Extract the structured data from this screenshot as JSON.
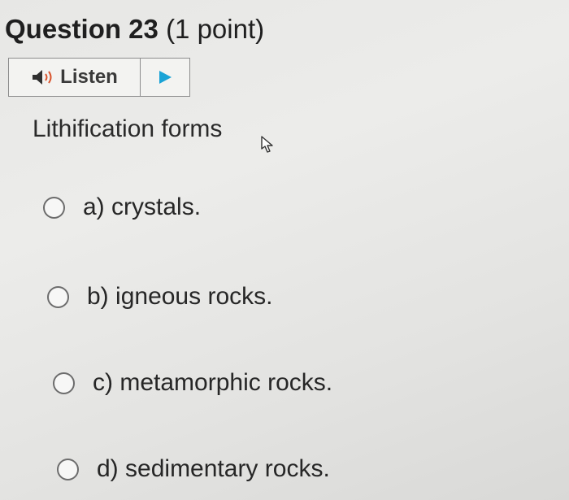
{
  "question": {
    "label": "Question 23",
    "points": "(1 point)"
  },
  "listen": {
    "label": "Listen",
    "speaker_icon": "speaker-icon",
    "play_icon": "play-icon",
    "play_color": "#1aa3d6",
    "speaker_accent": "#d9532c"
  },
  "prompt": "Lithification forms",
  "options": [
    {
      "letter": "a)",
      "text": "crystals."
    },
    {
      "letter": "b)",
      "text": "igneous rocks."
    },
    {
      "letter": "c)",
      "text": "metamorphic rocks."
    },
    {
      "letter": "d)",
      "text": "sedimentary rocks."
    }
  ],
  "cursor_icon": "mouse-pointer-icon"
}
